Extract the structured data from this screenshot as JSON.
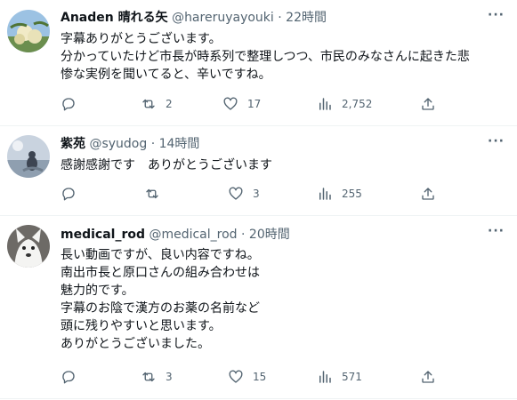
{
  "tweets": [
    {
      "name": "Anaden 晴れる矢",
      "handle": "@hareruyayouki",
      "dot": "·",
      "time": "22時間",
      "more": "···",
      "lines": [
        "字幕ありがとうございます。",
        "分かっていたけど市長が時系列で整理しつつ、市民のみなさんに起きた悲",
        "惨な実例を聞いてると、辛いですね。"
      ],
      "replies": "",
      "retweets": "2",
      "likes": "17",
      "views": "2,752"
    },
    {
      "name": "紫苑",
      "handle": "@syudog",
      "dot": "·",
      "time": "14時間",
      "more": "···",
      "lines": [
        "感謝感謝です　ありがとうございます"
      ],
      "replies": "",
      "retweets": "",
      "likes": "3",
      "views": "255"
    },
    {
      "name": "medical_rod",
      "handle": "@medical_rod",
      "dot": "·",
      "time": "20時間",
      "more": "···",
      "lines": [
        "長い動画ですが、良い内容ですね。",
        "南出市長と原口さんの組み合わせは",
        "魅力的です。",
        "字幕のお陰で漢方のお薬の名前など",
        "頭に残りやすいと思います。",
        "ありがとうございました。"
      ],
      "replies": "",
      "retweets": "3",
      "likes": "15",
      "views": "571"
    }
  ],
  "colors": {
    "text": "#0f1419",
    "secondary": "#536471",
    "separator": "#eff3f4"
  },
  "icons": [
    "reply-icon",
    "retweet-icon",
    "like-icon",
    "views-icon",
    "share-icon",
    "more-icon"
  ]
}
